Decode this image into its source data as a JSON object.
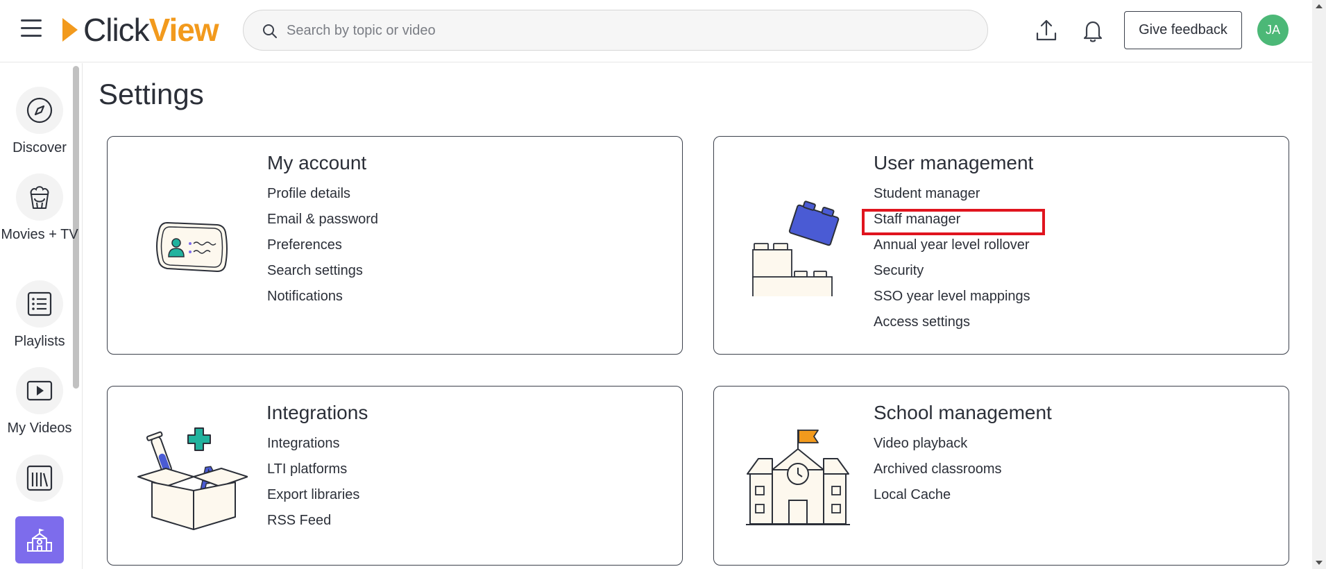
{
  "header": {
    "logo_part1": "Click",
    "logo_part2": "View",
    "search_placeholder": "Search by topic or video",
    "feedback_label": "Give feedback",
    "avatar_initials": "JA"
  },
  "sidebar": {
    "items": [
      {
        "label": "Discover",
        "icon": "compass-icon"
      },
      {
        "label": "Movies + TV",
        "icon": "popcorn-icon"
      },
      {
        "label": "Playlists",
        "icon": "playlist-icon"
      },
      {
        "label": "My Videos",
        "icon": "play-icon"
      },
      {
        "label": "",
        "icon": "library-icon"
      }
    ],
    "active_icon": "school-icon"
  },
  "page": {
    "title": "Settings"
  },
  "cards": {
    "my_account": {
      "title": "My account",
      "links": [
        "Profile details",
        "Email & password",
        "Preferences",
        "Search settings",
        "Notifications"
      ]
    },
    "user_management": {
      "title": "User management",
      "links": [
        "Student manager",
        "Staff manager",
        "Annual year level rollover",
        "Security",
        "SSO year level mappings",
        "Access settings"
      ]
    },
    "integrations": {
      "title": "Integrations",
      "links": [
        "Integrations",
        "LTI platforms",
        "Export libraries",
        "RSS Feed"
      ]
    },
    "school_management": {
      "title": "School management",
      "links": [
        "Video playback",
        "Archived classrooms",
        "Local Cache"
      ]
    }
  },
  "colors": {
    "brand_orange": "#f29a1d",
    "active_purple": "#7d6cec",
    "avatar_green": "#4cb877",
    "highlight_red": "#e0141e"
  }
}
